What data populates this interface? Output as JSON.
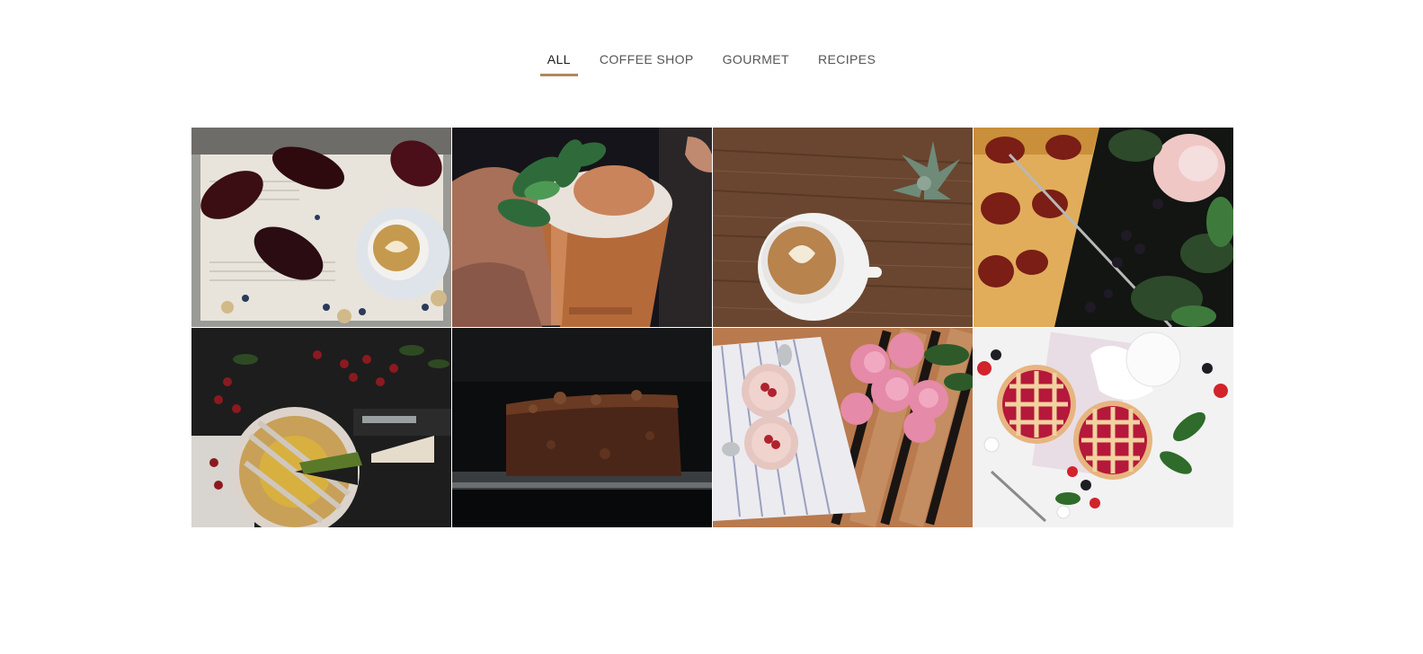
{
  "filters": [
    {
      "label": "ALL",
      "active": true
    },
    {
      "label": "COFFEE SHOP",
      "active": false
    },
    {
      "label": "GOURMET",
      "active": false
    },
    {
      "label": "RECIPES",
      "active": false
    }
  ],
  "colors": {
    "accent": "#b08a5a",
    "active_text": "#1c1c1c",
    "inactive_text": "#555555"
  },
  "gallery": [
    {
      "icon": "eclairs-latte-photo"
    },
    {
      "icon": "mint-drink-copper-cup-photo"
    },
    {
      "icon": "latte-art-succulent-photo"
    },
    {
      "icon": "plum-tart-blackberries-photo"
    },
    {
      "icon": "berry-tart-currants-photo"
    },
    {
      "icon": "brownie-slice-photo"
    },
    {
      "icon": "raspberry-mousse-peonies-photo"
    },
    {
      "icon": "lattice-berry-pies-photo"
    }
  ]
}
